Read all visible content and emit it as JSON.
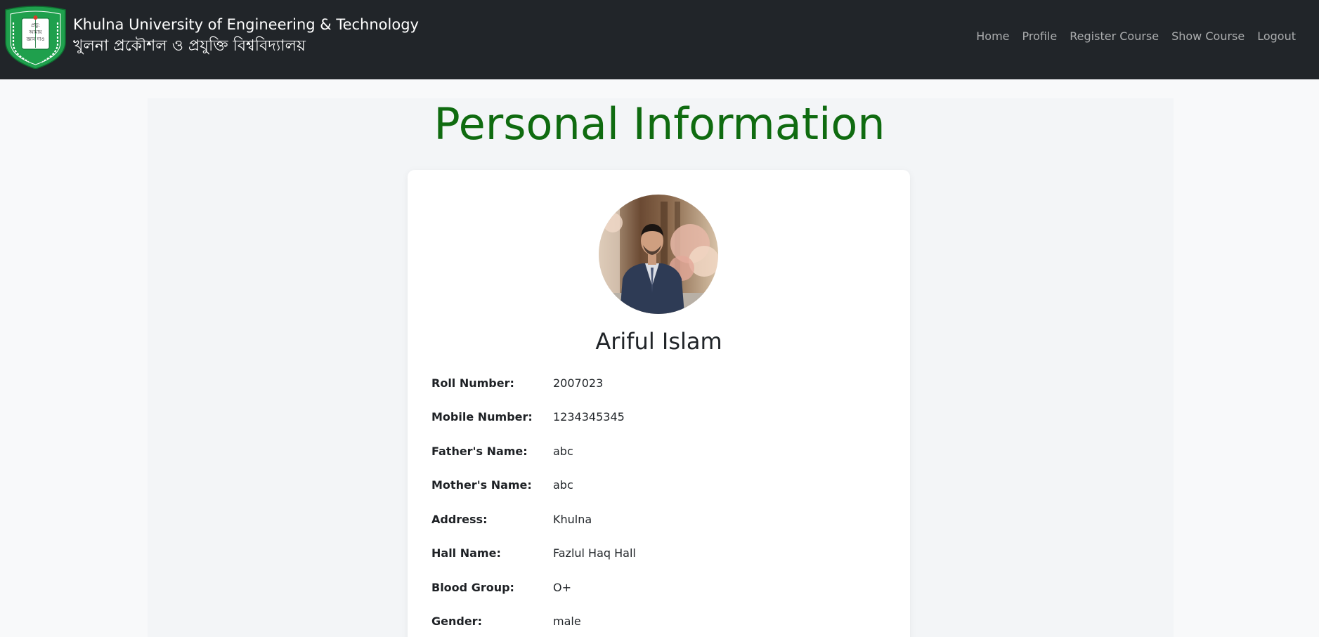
{
  "header": {
    "brand_en": "Khulna University of Engineering & Technology",
    "brand_bn": "খুলনা প্রকৌশল ও প্রযুক্তি বিশ্ববিদ্যালয়",
    "logo_text": {
      "book_line1": "প্রভু:",
      "book_line2": "আমায়",
      "book_line3": "জ্ঞান দাও",
      "ring": "খুলনা প্রকৌশল ও প্রযুক্তি বিশ্ববিদ্যালয়"
    },
    "nav": [
      {
        "label": "Home"
      },
      {
        "label": "Profile"
      },
      {
        "label": "Register Course"
      },
      {
        "label": "Show Course"
      },
      {
        "label": "Logout"
      }
    ]
  },
  "page": {
    "title": "Personal Information"
  },
  "profile": {
    "name": "Ariful Islam",
    "fields": [
      {
        "label": "Roll Number:",
        "value": "2007023"
      },
      {
        "label": "Mobile Number:",
        "value": "1234345345"
      },
      {
        "label": "Father's Name:",
        "value": "abc"
      },
      {
        "label": "Mother's Name:",
        "value": "abc"
      },
      {
        "label": "Address:",
        "value": "Khulna"
      },
      {
        "label": "Hall Name:",
        "value": "Fazlul Haq Hall"
      },
      {
        "label": "Blood Group:",
        "value": "O+"
      },
      {
        "label": "Gender:",
        "value": "male"
      }
    ]
  },
  "colors": {
    "navbar_bg": "#212529",
    "title_green": "#0f6b10",
    "logo_green": "#1fa04d",
    "page_bg": "#f8f9fa",
    "card_bg": "#ffffff"
  }
}
